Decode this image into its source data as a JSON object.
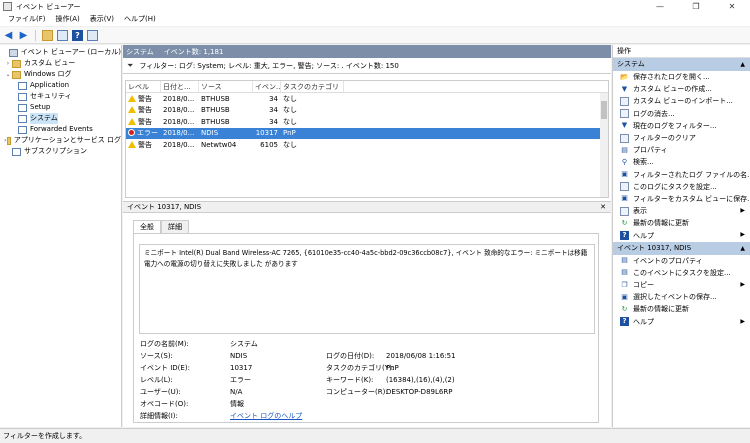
{
  "window": {
    "title": "イベント ビューアー",
    "minimize": "—",
    "maximize": "❐",
    "close": "✕"
  },
  "menu": [
    "ファイル(F)",
    "操作(A)",
    "表示(V)",
    "ヘルプ(H)"
  ],
  "tree": {
    "root": "イベント ビューアー (ローカル)",
    "custom_views": "カスタム ビュー",
    "windows_logs": "Windows ログ",
    "application": "Application",
    "security": "セキュリティ",
    "setup": "Setup",
    "system": "システム",
    "forwarded": "Forwarded Events",
    "apps_services": "アプリケーションとサービス ログ",
    "subscriptions": "サブスクリプション"
  },
  "center": {
    "header_name": "システム",
    "header_count": "イベント数: 1,181",
    "filter_text": "フィルター: ログ: System; レベル: 重大, エラー, 警告; ソース: . イベント数: 150",
    "columns": [
      "レベル",
      "日付と...",
      "ソース",
      "イベン...",
      "タスクのカテゴリ"
    ],
    "rows": [
      {
        "level": "警告",
        "date": "2018/0...",
        "source": "BTHUSB",
        "id": "34",
        "category": "なし",
        "type": "warn",
        "selected": false
      },
      {
        "level": "警告",
        "date": "2018/0...",
        "source": "BTHUSB",
        "id": "34",
        "category": "なし",
        "type": "warn",
        "selected": false
      },
      {
        "level": "警告",
        "date": "2018/0...",
        "source": "BTHUSB",
        "id": "34",
        "category": "なし",
        "type": "warn",
        "selected": false
      },
      {
        "level": "エラー",
        "date": "2018/0...",
        "source": "NDIS",
        "id": "10317",
        "category": "PnP",
        "type": "err",
        "selected": true
      },
      {
        "level": "警告",
        "date": "2018/0...",
        "source": "Netwtw04",
        "id": "6105",
        "category": "なし",
        "type": "warn",
        "selected": false
      }
    ]
  },
  "detail": {
    "header": "イベント 10317, NDIS",
    "close": "✕",
    "tab_general": "全般",
    "tab_details": "詳細",
    "message": "ミニポート Intel(R) Dual Band Wireless-AC 7265, {61010e35-cc40-4a5c-bbd2-09c36ccb08c7}, イベント 致命的なエラー: ミニポートは移籍電力への電源の切り替えに失敗しました があります",
    "labels": {
      "log_name": "ログの名前(M):",
      "source": "ソース(S):",
      "event_id": "イベント ID(E):",
      "level": "レベル(L):",
      "user": "ユーザー(U):",
      "opcode": "オペコード(O):",
      "more_info": "詳細情報(I):",
      "logged": "ログの日付(D):",
      "task": "タスクのカテゴリ(Y):",
      "keywords": "キーワード(K):",
      "computer": "コンピューター(R):"
    },
    "values": {
      "log_name": "システム",
      "source": "NDIS",
      "event_id": "10317",
      "level": "エラー",
      "user": "N/A",
      "opcode": "情報",
      "more_info": "イベント ログのヘルプ",
      "logged": "2018/06/08 1:16:51",
      "task": "PnP",
      "keywords": "(16384),(16),(4),(2)",
      "computer": "DESKTOP-D89L6RP"
    }
  },
  "actions": {
    "title": "操作",
    "section1": "システム",
    "items1": [
      {
        "label": "保存されたログを開く...",
        "icon": "folder-open-icon",
        "glyph": "📂",
        "sub": false
      },
      {
        "label": "カスタム ビューの作成...",
        "icon": "filter-add-icon",
        "glyph": "▼",
        "sub": false
      },
      {
        "label": "カスタム ビューのインポート...",
        "icon": "import-icon",
        "glyph": "",
        "sub": false
      },
      {
        "label": "ログの消去...",
        "icon": "clear-log-icon",
        "glyph": "",
        "sub": false
      },
      {
        "label": "現在のログをフィルター...",
        "icon": "filter-icon",
        "glyph": "▼",
        "sub": false
      },
      {
        "label": "フィルターのクリア",
        "icon": "filter-clear-icon",
        "glyph": "",
        "sub": false
      },
      {
        "label": "プロパティ",
        "icon": "properties-icon",
        "glyph": "▤",
        "sub": false
      },
      {
        "label": "検索...",
        "icon": "find-icon",
        "glyph": "⚲",
        "sub": false
      },
      {
        "label": "フィルターされたログ ファイルの名...",
        "icon": "save-icon",
        "glyph": "▣",
        "sub": false
      },
      {
        "label": "このログにタスクを設定...",
        "icon": "task-icon",
        "glyph": "",
        "sub": false
      },
      {
        "label": "フィルターをカスタム ビューに保存...",
        "icon": "save-filter-icon",
        "glyph": "▣",
        "sub": false
      },
      {
        "label": "表示",
        "icon": "view-icon",
        "glyph": "",
        "sub": true
      },
      {
        "label": "最新の情報に更新",
        "icon": "refresh-icon",
        "glyph": "↻",
        "sub": false
      },
      {
        "label": "ヘルプ",
        "icon": "help-icon",
        "glyph": "?",
        "sub": true
      }
    ],
    "section2": "イベント 10317, NDIS",
    "items2": [
      {
        "label": "イベントのプロパティ",
        "icon": "event-properties-icon",
        "glyph": "▤",
        "sub": false
      },
      {
        "label": "このイベントにタスクを設定...",
        "icon": "event-task-icon",
        "glyph": "▤",
        "sub": false
      },
      {
        "label": "コピー",
        "icon": "copy-icon",
        "glyph": "❐",
        "sub": true
      },
      {
        "label": "選択したイベントの保存...",
        "icon": "save-events-icon",
        "glyph": "▣",
        "sub": false
      },
      {
        "label": "最新の情報に更新",
        "icon": "refresh-icon",
        "glyph": "↻",
        "sub": false
      },
      {
        "label": "ヘルプ",
        "icon": "help-icon",
        "glyph": "?",
        "sub": true
      }
    ]
  },
  "status": "フィルターを作成します。"
}
